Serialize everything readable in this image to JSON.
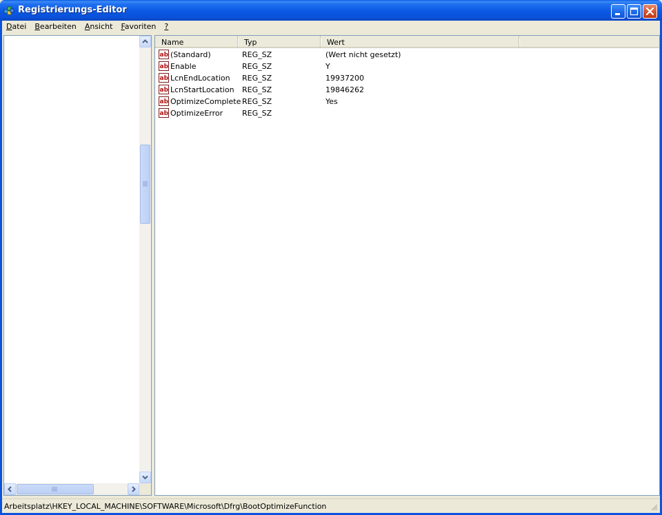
{
  "window": {
    "title": "Registrierungs-Editor",
    "title_icon": "regedit-icon",
    "buttons": [
      "minimize",
      "maximize",
      "close"
    ]
  },
  "menu": [
    {
      "label": "Datei",
      "underline": "D",
      "rest": "atei"
    },
    {
      "label": "Bearbeiten",
      "underline": "B",
      "rest": "earbeiten"
    },
    {
      "label": "Ansicht",
      "underline": "A",
      "rest": "nsicht"
    },
    {
      "label": "Favoriten",
      "underline": "F",
      "rest": "avoriten"
    },
    {
      "label": "?",
      "underline": "?",
      "rest": ""
    }
  ],
  "list": {
    "columns": [
      "Name",
      "Typ",
      "Wert"
    ],
    "rows": [
      {
        "name": "(Standard)",
        "type": "REG_SZ",
        "value": "(Wert nicht gesetzt)",
        "icon": "string-value-icon"
      },
      {
        "name": "Enable",
        "type": "REG_SZ",
        "value": "Y",
        "icon": "string-value-icon"
      },
      {
        "name": "LcnEndLocation",
        "type": "REG_SZ",
        "value": "19937200",
        "icon": "string-value-icon"
      },
      {
        "name": "LcnStartLocation",
        "type": "REG_SZ",
        "value": "19846262",
        "icon": "string-value-icon"
      },
      {
        "name": "OptimizeComplete",
        "type": "REG_SZ",
        "value": "Yes",
        "icon": "string-value-icon"
      },
      {
        "name": "OptimizeError",
        "type": "REG_SZ",
        "value": "",
        "icon": "string-value-icon"
      }
    ]
  },
  "statusbar": {
    "path": "Arbeitsplatz\\HKEY_LOCAL_MACHINE\\SOFTWARE\\Microsoft\\Dfrg\\BootOptimizeFunction"
  },
  "colors": {
    "titlebar": "#0a5ce8",
    "close_button": "#d2532e",
    "face": "#ece9d8",
    "pane_border": "#7f9db9"
  }
}
